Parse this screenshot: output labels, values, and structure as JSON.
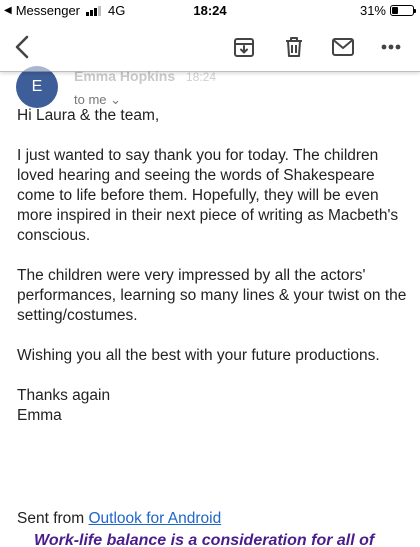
{
  "status_bar": {
    "back_app": "Messenger",
    "network": "4G",
    "time": "18:24",
    "battery_label": "31%",
    "battery_level": 0.31
  },
  "header": {
    "avatar_initial": "E",
    "sender_name": "Emma Hopkins",
    "sent_time": "18:24",
    "to_me": "to me ⌄"
  },
  "toolbar": {
    "back_icon": "back-arrow-icon",
    "archive_icon": "archive-icon",
    "delete_icon": "trash-icon",
    "mark_unread_icon": "envelope-icon",
    "more_icon": "more-vertical-icon"
  },
  "email": {
    "greeting": "Hi Laura & the team,",
    "paragraph_1": "I just wanted to say thank you for today. The children loved hearing and seeing the words of Shakespeare come to life before them. Hopefully, they will be even more inspired in their next piece of writing as Macbeth's conscious.",
    "paragraph_2": "The children were very impressed by all the actors' performances, learning so many lines & your twist on the setting/costumes.",
    "paragraph_3": "Wishing you all the best with your future productions.",
    "sign_off_1": "Thanks again",
    "sign_off_2": "Emma",
    "sent_from_prefix": "Sent from ",
    "sent_from_link": "Outlook for Android",
    "footer_note": "Work-life balance is a consideration for all of"
  }
}
